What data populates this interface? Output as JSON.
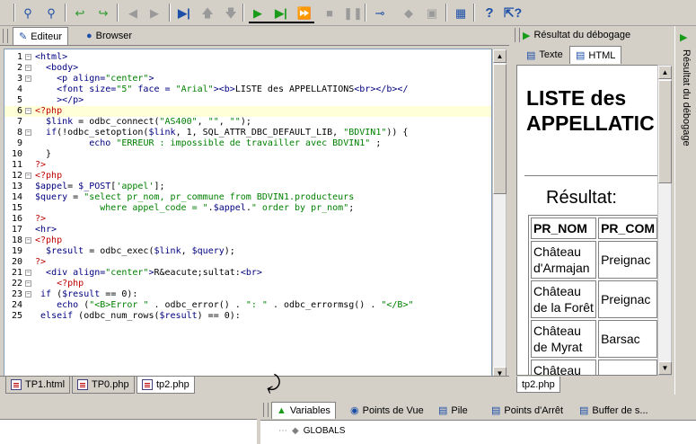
{
  "toolbar": {
    "icons": [
      "search-icon",
      "search-replace-icon",
      "arrow-left-green-icon",
      "arrow-right-green-icon",
      "back-icon",
      "forward-icon",
      "step-into-icon",
      "step-up-icon",
      "step-down-icon",
      "run-icon",
      "run-to-cursor-icon",
      "run-fast-icon",
      "stop-icon",
      "pause-icon",
      "profile-icon",
      "breakpoint-icon",
      "square-icon",
      "calendar-icon",
      "help-icon",
      "context-help-icon"
    ]
  },
  "editor": {
    "tabs": [
      {
        "label": "Editeur",
        "active": true
      },
      {
        "label": "Browser",
        "active": false
      }
    ],
    "lines": [
      {
        "n": "1",
        "fold": "-",
        "html": "<span class='tag'>&lt;html&gt;</span>"
      },
      {
        "n": "2",
        "fold": "-",
        "html": "  <span class='tag'>&lt;body&gt;</span>"
      },
      {
        "n": "3",
        "fold": "-",
        "html": "    <span class='tag'>&lt;p align=</span><span class='str'>\"center\"</span><span class='tag'>&gt;</span>"
      },
      {
        "n": "4",
        "fold": "",
        "html": "    <span class='tag'>&lt;font size=</span><span class='str'>\"5\"</span><span class='tag'> face = </span><span class='str'>\"Arial\"</span><span class='tag'>&gt;&lt;b&gt;</span>LISTE des APPELLATIONS<span class='tag'>&lt;br&gt;&lt;/b&gt;&lt;/</span>"
      },
      {
        "n": "5",
        "fold": "",
        "html": "    <span class='tag'>&gt;&lt;/p&gt;</span>"
      },
      {
        "n": "6",
        "fold": "-",
        "hl": true,
        "html": "<span class='php'>&lt;?php</span>"
      },
      {
        "n": "7",
        "fold": "",
        "html": "  <span class='var'>$link</span> = odbc_connect(<span class='str'>\"AS400\"</span>, <span class='str'>\"\"</span>, <span class='str'>\"\"</span>);"
      },
      {
        "n": "8",
        "fold": "-",
        "html": "  <span class='kw'>if</span>(!odbc_setoption(<span class='var'>$link</span>, 1, SQL_ATTR_DBC_DEFAULT_LIB, <span class='str'>\"BDVIN1\"</span>)) {"
      },
      {
        "n": "9",
        "fold": "",
        "html": "          <span class='kw'>echo</span> <span class='str'>\"ERREUR : impossible de travailler avec BDVIN1\"</span> ;"
      },
      {
        "n": "10",
        "fold": "",
        "html": "  }"
      },
      {
        "n": "11",
        "fold": "",
        "html": "<span class='php'>?&gt;</span>"
      },
      {
        "n": "12",
        "fold": "-",
        "html": "<span class='php'>&lt;?php</span>"
      },
      {
        "n": "13",
        "fold": "",
        "html": "<span class='var'>$appel</span>= <span class='var'>$_POST</span>[<span class='str'>'appel'</span>];"
      },
      {
        "n": "14",
        "fold": "",
        "html": "<span class='var'>$query</span> = <span class='str'>\"select pr_nom, pr_commune from BDVIN1.producteurs</span>"
      },
      {
        "n": "15",
        "fold": "",
        "html": "<span class='str'>            where appel_code = \"</span>.<span class='var'>$appel</span>.<span class='str'>\" order by pr_nom\"</span>;"
      },
      {
        "n": "16",
        "fold": "",
        "html": "<span class='php'>?&gt;</span>"
      },
      {
        "n": "17",
        "fold": "",
        "html": "<span class='tag'>&lt;hr&gt;</span>"
      },
      {
        "n": "18",
        "fold": "-",
        "html": "<span class='php'>&lt;?php</span>"
      },
      {
        "n": "19",
        "fold": "",
        "html": "  <span class='var'>$result</span> = odbc_exec(<span class='var'>$link</span>, <span class='var'>$query</span>);"
      },
      {
        "n": "20",
        "fold": "",
        "html": "<span class='php'>?&gt;</span>"
      },
      {
        "n": "21",
        "fold": "-",
        "html": "  <span class='tag'>&lt;div align=</span><span class='str'>\"center\"</span><span class='tag'>&gt;</span>R&amp;eacute;sultat:<span class='tag'>&lt;br&gt;</span>"
      },
      {
        "n": "22",
        "fold": "-",
        "html": "    <span class='php'>&lt;?php</span>"
      },
      {
        "n": "23",
        "fold": "-",
        "html": " <span class='kw'>if</span> (<span class='var'>$result</span> == 0):"
      },
      {
        "n": "24",
        "fold": "",
        "html": "    <span class='kw'>echo</span> (<span class='str'>\"&lt;B&gt;Error \"</span> . odbc_error() . <span class='str'>\": \"</span> . odbc_errormsg() . <span class='str'>\"&lt;/B&gt;\"</span>"
      },
      {
        "n": "25",
        "fold": "",
        "html": " <span class='kw'>elseif</span> (odbc_num_rows(<span class='var'>$result</span>) == 0):"
      }
    ],
    "file_tabs": [
      {
        "label": "TP1.html",
        "active": false
      },
      {
        "label": "TP0.php",
        "active": false
      },
      {
        "label": "tp2.php",
        "active": true
      }
    ]
  },
  "debug": {
    "title": "Résultat du débogage",
    "tabs": [
      {
        "label": "Texte",
        "active": false
      },
      {
        "label": "HTML",
        "active": true
      }
    ],
    "page_title": "LISTE des APPELLATIC",
    "result_label": "Résultat:",
    "table_headers": [
      "PR_NOM",
      "PR_COM"
    ],
    "table_rows": [
      [
        "Château d'Armajan",
        "Preignac"
      ],
      [
        "Château de la Forêt",
        "Preignac"
      ],
      [
        "Château de Myrat",
        "Barsac"
      ],
      [
        "Château",
        ""
      ]
    ],
    "bottom_tab": "tp2.php",
    "side_label": "Résultat du débogage"
  },
  "bottom": {
    "tabs": [
      {
        "label": "Variables",
        "active": true,
        "icon": "variables-icon"
      },
      {
        "label": "Points de Vue",
        "active": false,
        "icon": "binoculars-icon"
      },
      {
        "label": "Pile",
        "active": false,
        "icon": "stack-icon"
      },
      {
        "label": "Points d'Arrêt",
        "active": false,
        "icon": "breakpoints-icon"
      },
      {
        "label": "Buffer de s...",
        "active": false,
        "icon": "buffer-icon"
      }
    ],
    "globals_label": "GLOBALS"
  }
}
